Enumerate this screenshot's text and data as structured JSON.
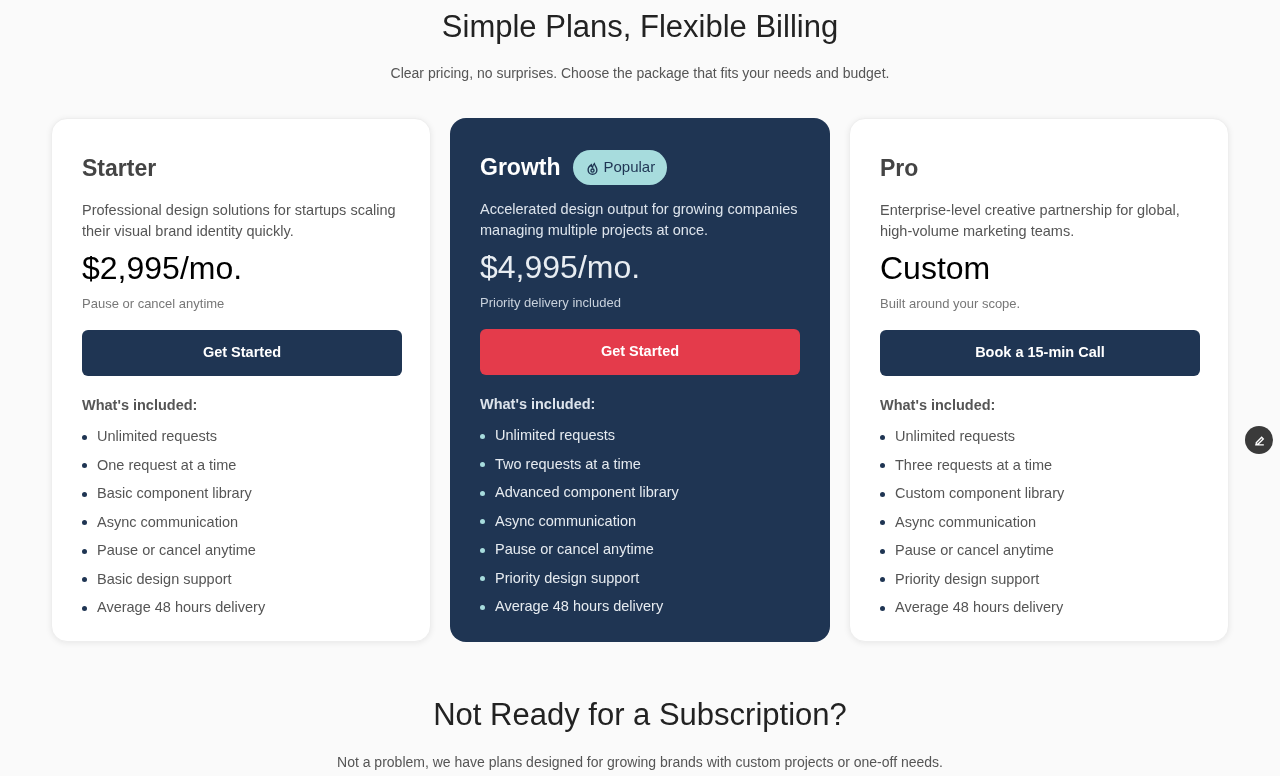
{
  "header": {
    "title": "Simple Plans, Flexible Billing",
    "subtitle": "Clear pricing, no surprises. Choose the package that fits your needs and budget."
  },
  "plans": [
    {
      "name": "Starter",
      "featured": false,
      "description": "Professional design solutions for startups scaling their visual brand identity quickly.",
      "price": "$2,995/mo.",
      "note": "Pause or cancel anytime",
      "button": "Get Started",
      "included_title": "What's included:",
      "features": [
        "Unlimited requests",
        "One request at a time",
        "Basic component library",
        "Async communication",
        "Pause or cancel anytime",
        "Basic design support",
        "Average 48 hours delivery"
      ]
    },
    {
      "name": "Growth",
      "featured": true,
      "badge": "Popular",
      "description": "Accelerated design output for growing companies managing multiple projects at once.",
      "price": "$4,995/mo.",
      "note": "Priority delivery included",
      "button": "Get Started",
      "included_title": "What's included:",
      "features": [
        "Unlimited requests",
        "Two requests at a time",
        "Advanced component library",
        "Async communication",
        "Pause or cancel anytime",
        "Priority design support",
        "Average 48 hours delivery"
      ]
    },
    {
      "name": "Pro",
      "featured": false,
      "description": "Enterprise-level creative partnership for global, high-volume marketing teams.",
      "price": "Custom",
      "note": "Built around your scope.",
      "button": "Book a 15-min Call",
      "included_title": "What's included:",
      "features": [
        "Unlimited requests",
        "Three requests at a time",
        "Custom component library",
        "Async communication",
        "Pause or cancel anytime",
        "Priority design support",
        "Average 48 hours delivery"
      ]
    }
  ],
  "footer": {
    "title": "Not Ready for a Subscription?",
    "subtitle": "Not a problem, we have plans designed for growing brands with custom projects or one-off needs."
  }
}
